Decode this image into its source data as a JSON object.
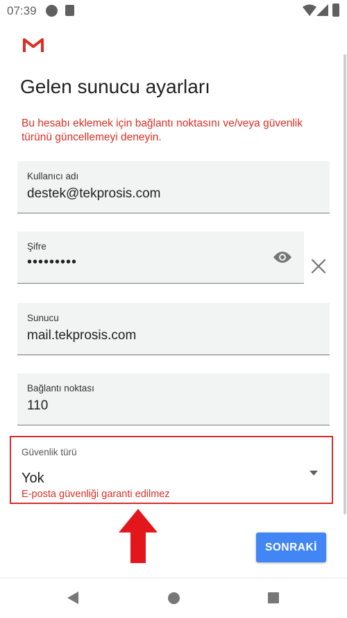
{
  "status_bar": {
    "time": "07:39"
  },
  "header": {
    "title": "Gelen sunucu ayarları"
  },
  "error_message": "Bu hesabı eklemek için bağlantı noktasını ve/veya güvenlik türünü güncellemeyi deneyin.",
  "fields": {
    "username": {
      "label": "Kullanıcı adı",
      "value": "destek@tekprosis.com"
    },
    "password": {
      "label": "Şifre",
      "value": "•••••••••"
    },
    "server": {
      "label": "Sunucu",
      "value": "mail.tekprosis.com"
    },
    "port": {
      "label": "Bağlantı noktası",
      "value": "110"
    }
  },
  "security": {
    "label": "Güvenlik türü",
    "value": "Yok",
    "helper_text": "E-posta güvenliği garanti edilmez"
  },
  "next_button": {
    "label": "SONRAKİ"
  },
  "colors": {
    "accent": "#4285f4",
    "error": "#d93025",
    "highlight": "#d92b2b"
  },
  "icons": [
    "gmail-logo-icon",
    "eye-icon",
    "clear-icon",
    "dropdown-arrow-icon",
    "red-arrow-icon",
    "back-icon",
    "home-icon",
    "recents-icon"
  ]
}
